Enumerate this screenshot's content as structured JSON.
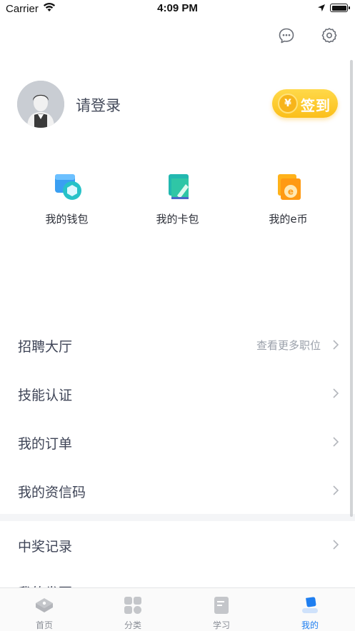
{
  "status_bar": {
    "carrier": "Carrier",
    "time": "4:09 PM"
  },
  "profile": {
    "login_text": "请登录",
    "signin_label": "签到",
    "coin_symbol": "¥"
  },
  "quick_actions": [
    {
      "label": "我的钱包",
      "icon": "wallet-icon"
    },
    {
      "label": "我的卡包",
      "icon": "card-bag-icon"
    },
    {
      "label": "我的e币",
      "icon": "e-coin-icon"
    }
  ],
  "menu": [
    {
      "label": "招聘大厅",
      "extra": "查看更多职位"
    },
    {
      "label": "技能认证",
      "extra": ""
    },
    {
      "label": "我的订单",
      "extra": ""
    },
    {
      "label": "我的资信码",
      "extra": ""
    },
    {
      "label": "中奖记录",
      "extra": ""
    }
  ],
  "menu_peek_label": "我的发票",
  "tabs": [
    {
      "label": "首页",
      "icon": "home-icon",
      "active": false
    },
    {
      "label": "分类",
      "icon": "category-icon",
      "active": false
    },
    {
      "label": "学习",
      "icon": "study-icon",
      "active": false
    },
    {
      "label": "我的",
      "icon": "profile-icon",
      "active": true
    }
  ],
  "colors": {
    "accent": "#1e7ef0",
    "signin_gold": "#fbbf1a",
    "text_primary": "#3f4557",
    "text_muted": "#9aa0aa"
  }
}
